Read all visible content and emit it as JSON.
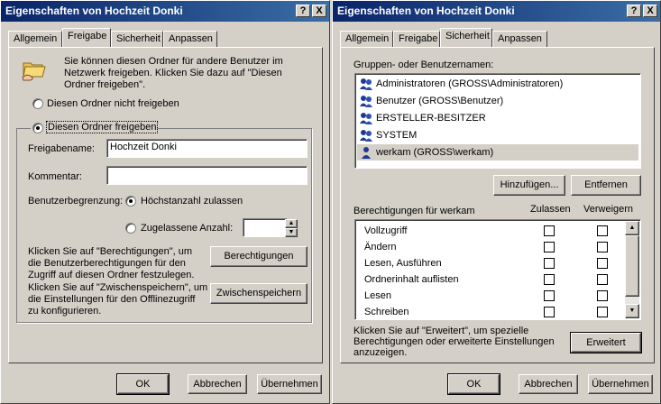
{
  "left": {
    "title": "Eigenschaften von Hochzeit Donki",
    "tabs": [
      "Allgemein",
      "Freigabe",
      "Sicherheit",
      "Anpassen"
    ],
    "description": "Sie können diesen Ordner für andere Benutzer im Netzwerk freigeben. Klicken Sie dazu auf \"Diesen Ordner freigeben\".",
    "radio_no_share": "Diesen Ordner nicht freigeben",
    "radio_share": "Diesen Ordner freigeben",
    "share_name_label": "Freigabename:",
    "share_name_value": "Hochzeit Donki",
    "comment_label": "Kommentar:",
    "comment_value": "",
    "user_limit_label": "Benutzerbegrenzung:",
    "radio_max": "Höchstanzahl zulassen",
    "radio_allowed": "Zugelassene Anzahl:",
    "allowed_value": "",
    "perm_text": "Klicken Sie auf \"Berechtigungen\", um die Benutzerberechtigungen für den Zugriff auf diesen Ordner festzulegen.",
    "perm_button": "Berechtigungen",
    "cache_text": "Klicken Sie auf \"Zwischenspeichern\", um die Einstellungen für den Offlinezugriff zu konfigurieren.",
    "cache_button": "Zwischenspeichern",
    "ok": "OK",
    "cancel": "Abbrechen",
    "apply": "Übernehmen"
  },
  "right": {
    "title": "Eigenschaften von Hochzeit Donki",
    "tabs": [
      "Allgemein",
      "Freigabe",
      "Sicherheit",
      "Anpassen"
    ],
    "group_label": "Gruppen- oder Benutzernamen:",
    "users": [
      "Administratoren (GROSS\\Administratoren)",
      "Benutzer (GROSS\\Benutzer)",
      "ERSTELLER-BESITZER",
      "SYSTEM",
      "werkam (GROSS\\werkam)"
    ],
    "add_button": "Hinzufügen...",
    "remove_button": "Entfernen",
    "perm_label": "Berechtigungen für werkam",
    "allow_header": "Zulassen",
    "deny_header": "Verweigern",
    "permissions": [
      "Vollzugriff",
      "Ändern",
      "Lesen, Ausführen",
      "Ordnerinhalt auflisten",
      "Lesen",
      "Schreiben"
    ],
    "advanced_text": "Klicken Sie auf \"Erweitert\", um spezielle Berechtigungen oder erweiterte Einstellungen anzuzeigen.",
    "advanced_button": "Erweitert",
    "ok": "OK",
    "cancel": "Abbrechen",
    "apply": "Übernehmen"
  },
  "titlebar_buttons": {
    "help": "?",
    "close": "X"
  },
  "colors": {
    "titlebar_start": "#0a246a",
    "titlebar_end": "#3a6ea5",
    "face": "#d4d0c8",
    "selection": "#d4d0c8"
  }
}
